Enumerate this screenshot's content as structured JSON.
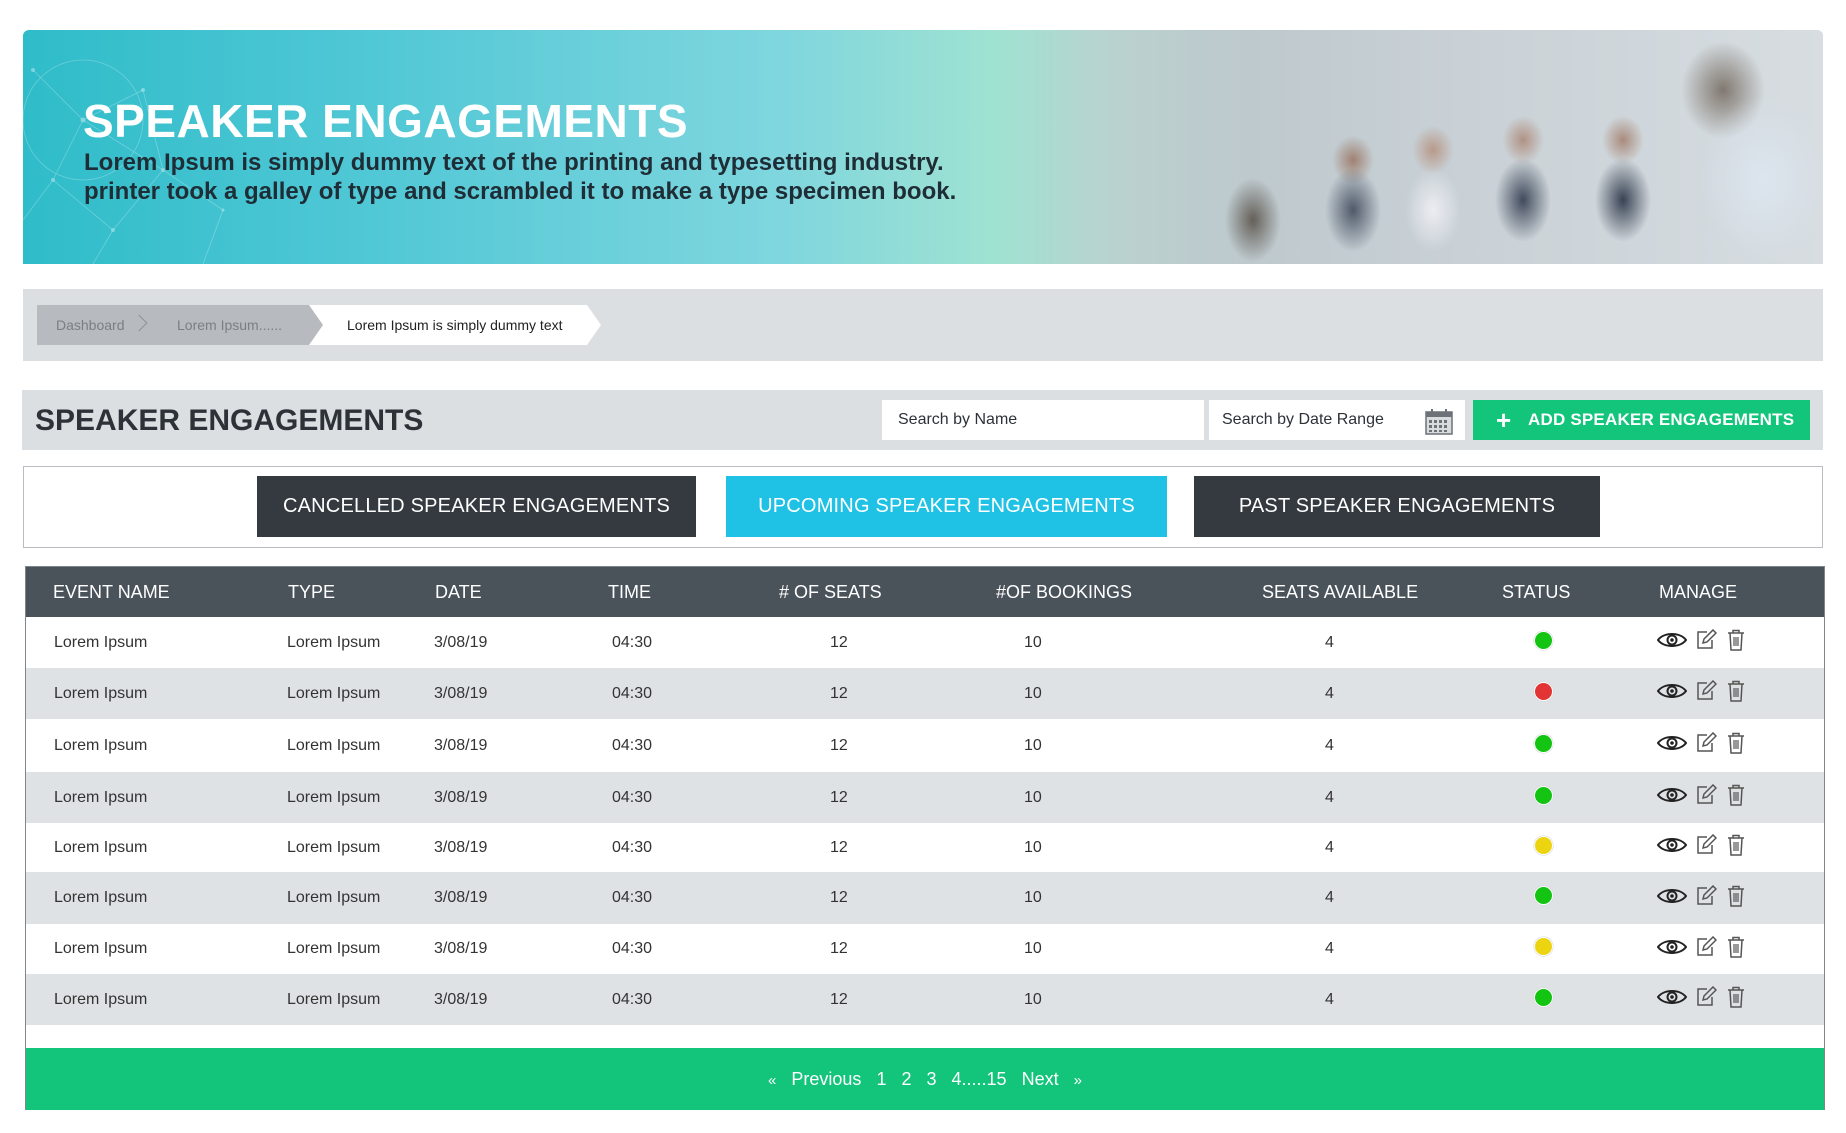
{
  "hero": {
    "title": "SPEAKER ENGAGEMENTS",
    "subtitle_line1": "Lorem Ipsum is simply dummy text of the printing and typesetting industry.",
    "subtitle_line2": "printer took a galley of type and scrambled it to make a type specimen book."
  },
  "breadcrumb": {
    "items": [
      {
        "label": "Dashboard"
      },
      {
        "label": "Lorem Ipsum......"
      },
      {
        "label": "Lorem Ipsum is simply dummy text"
      }
    ]
  },
  "section": {
    "title": "SPEAKER ENGAGEMENTS",
    "search_name_placeholder": "Search by Name",
    "search_date_placeholder": "Search by Date Range",
    "add_button_label": "ADD SPEAKER ENGAGEMENTS",
    "add_button_icon": "plus-icon",
    "accent_color": "#13c47b"
  },
  "tabs": [
    {
      "label": "CANCELLED SPEAKER ENGAGEMENTS",
      "active": false
    },
    {
      "label": "UPCOMING SPEAKER ENGAGEMENTS",
      "active": true
    },
    {
      "label": "PAST SPEAKER ENGAGEMENTS",
      "active": false
    }
  ],
  "table": {
    "headers": [
      "EVENT NAME",
      "TYPE",
      "DATE",
      "TIME",
      "# OF SEATS",
      "#OF BOOKINGS",
      "SEATS AVAILABLE",
      "STATUS",
      "MANAGE"
    ],
    "status_colors": {
      "green": "#13c413",
      "red": "#e23434",
      "yellow": "#ecd411"
    },
    "manage_icons": [
      "eye-icon",
      "edit-icon",
      "trash-icon"
    ],
    "rows": [
      {
        "event": "Lorem Ipsum",
        "type": "Lorem Ipsum",
        "date": "3/08/19",
        "time": "04:30",
        "seats": "12",
        "bookings": "10",
        "available": "4",
        "status": "green"
      },
      {
        "event": "Lorem Ipsum",
        "type": "Lorem Ipsum",
        "date": "3/08/19",
        "time": "04:30",
        "seats": "12",
        "bookings": "10",
        "available": "4",
        "status": "red"
      },
      {
        "event": "Lorem Ipsum",
        "type": "Lorem Ipsum",
        "date": "3/08/19",
        "time": "04:30",
        "seats": "12",
        "bookings": "10",
        "available": "4",
        "status": "green"
      },
      {
        "event": "Lorem Ipsum",
        "type": "Lorem Ipsum",
        "date": "3/08/19",
        "time": "04:30",
        "seats": "12",
        "bookings": "10",
        "available": "4",
        "status": "green"
      },
      {
        "event": "Lorem Ipsum",
        "type": "Lorem Ipsum",
        "date": "3/08/19",
        "time": "04:30",
        "seats": "12",
        "bookings": "10",
        "available": "4",
        "status": "yellow"
      },
      {
        "event": "Lorem Ipsum",
        "type": "Lorem Ipsum",
        "date": "3/08/19",
        "time": "04:30",
        "seats": "12",
        "bookings": "10",
        "available": "4",
        "status": "green"
      },
      {
        "event": "Lorem Ipsum",
        "type": "Lorem Ipsum",
        "date": "3/08/19",
        "time": "04:30",
        "seats": "12",
        "bookings": "10",
        "available": "4",
        "status": "yellow"
      },
      {
        "event": "Lorem Ipsum",
        "type": "Lorem Ipsum",
        "date": "3/08/19",
        "time": "04:30",
        "seats": "12",
        "bookings": "10",
        "available": "4",
        "status": "green"
      }
    ]
  },
  "pagination": {
    "prev_icon": "«",
    "prev_label": "Previous",
    "pages": [
      "1",
      "2",
      "3",
      "4.....15"
    ],
    "next_label": "Next",
    "next_icon": "»"
  }
}
